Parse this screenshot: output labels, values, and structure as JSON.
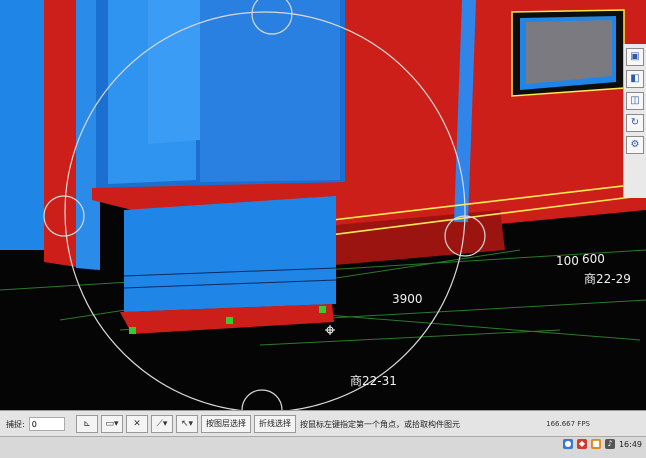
{
  "viewport": {
    "dimensions": {
      "d1": "100",
      "d2": "600",
      "d3": "3900"
    },
    "grid_labels": {
      "g1": "商22-29",
      "g2": "商22-31"
    },
    "cursor_icon": "crosshair-icon"
  },
  "right_toolbar": {
    "icons": [
      "view-cube-icon",
      "view-front-icon",
      "view-top-icon",
      "rotate-icon",
      "settings-icon"
    ]
  },
  "statusbar": {
    "field_label": "捕捉:",
    "field_value": "0",
    "buttons": {
      "layer_select": "按图层选择",
      "polyline_select": "折线选择"
    },
    "hint": "按鼠标左键指定第一个角点，或拾取构件图元",
    "fps": "166.667 FPS"
  },
  "taskbar": {
    "time": "16:49"
  },
  "colors": {
    "wall_red": "#cc1f1a",
    "glass_blue": "#1f86e8",
    "highlight_yellow": "#ffe94d",
    "grid_green": "#2a7a2a",
    "snap_green": "#33cc33"
  }
}
